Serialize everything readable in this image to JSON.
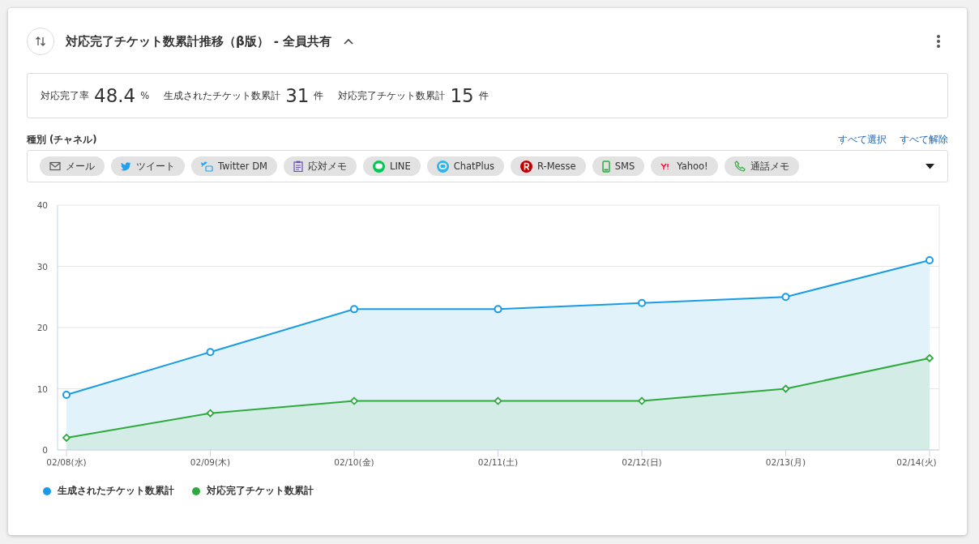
{
  "header": {
    "title": "対応完了チケット数累計推移（β版）",
    "share": "- 全員共有",
    "expanded": true
  },
  "summary": [
    {
      "label": "対応完了率",
      "value": "48.4",
      "unit": "%"
    },
    {
      "label": "生成されたチケット数累計",
      "value": "31",
      "unit": "件"
    },
    {
      "label": "対応完了チケット数累計",
      "value": "15",
      "unit": "件"
    }
  ],
  "filter": {
    "label": "種別 (チャネル)",
    "select_all": "すべて選択",
    "clear_all": "すべて解除",
    "channels": [
      {
        "kind": "mail",
        "label": "メール"
      },
      {
        "kind": "tweet",
        "label": "ツイート"
      },
      {
        "kind": "dm",
        "label": "Twitter DM"
      },
      {
        "kind": "memo",
        "label": "応対メモ"
      },
      {
        "kind": "line",
        "label": "LINE"
      },
      {
        "kind": "chatplus",
        "label": "ChatPlus"
      },
      {
        "kind": "rmesse",
        "label": "R-Messe"
      },
      {
        "kind": "sms",
        "label": "SMS"
      },
      {
        "kind": "yahoo",
        "label": "Yahoo!"
      },
      {
        "kind": "call",
        "label": "通話メモ"
      }
    ]
  },
  "chart_data": {
    "type": "area",
    "grid": true,
    "categories": [
      "02/08(水)",
      "02/09(木)",
      "02/10(金)",
      "02/11(土)",
      "02/12(日)",
      "02/13(月)",
      "02/14(火)"
    ],
    "ylim": [
      0,
      40
    ],
    "yticks": [
      0,
      10,
      20,
      30,
      40
    ],
    "series": [
      {
        "name": "生成されたチケット数累計",
        "color": "#1a9be6",
        "values": [
          9,
          16,
          23,
          23,
          24,
          25,
          31
        ]
      },
      {
        "name": "対応完了チケット数累計",
        "color": "#2eaa3c",
        "values": [
          2,
          6,
          8,
          8,
          8,
          10,
          15
        ]
      }
    ]
  }
}
